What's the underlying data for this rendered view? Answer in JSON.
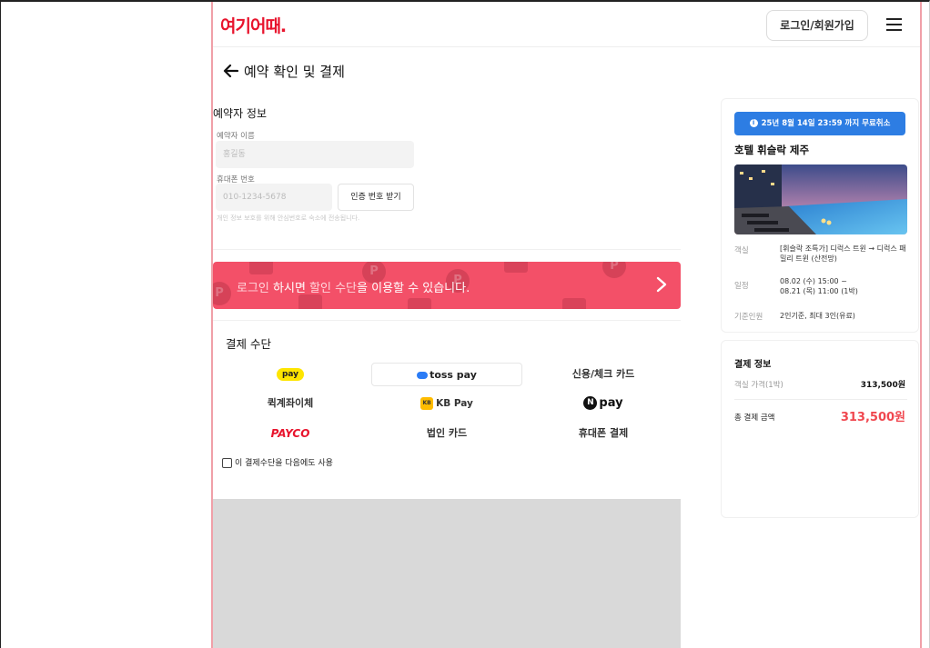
{
  "header": {
    "logo": "여기어때.",
    "login_label": "로그인/회원가입"
  },
  "page": {
    "title": "예약 확인 및 결제"
  },
  "booker": {
    "section_title": "예약자 정보",
    "name_label": "예약자 이름",
    "name_placeholder": "홍길동",
    "phone_label": "휴대폰 번호",
    "phone_placeholder": "010-1234-5678",
    "verify_label": "인증 번호 받기",
    "notice": "개인 정보 보호를 위해 안심번호로 숙소에 전송됩니다."
  },
  "banner": {
    "part1": "로그인",
    "part2": " 하시면 ",
    "part3": "할인 수단",
    "part4": "을 이용할 수 있습니다."
  },
  "payment": {
    "title": "결제 수단",
    "options": {
      "kakaopay": "pay",
      "tosspay": "toss pay",
      "card": "신용/체크 카드",
      "quick_transfer": "퀵계좌이체",
      "kbpay": "KB Pay",
      "kbpay_badge": "KB",
      "npay": "pay",
      "npay_badge": "N",
      "payco": "PAYCO",
      "corporate_card": "법인 카드",
      "phone_payment": "휴대폰 결제"
    },
    "remember_label": "이 결제수단을 다음에도 사용"
  },
  "summary": {
    "cancel_badge": "25년 8월 14일 23:59 까지 무료취소",
    "hotel_name": "호텔 휘슬락 제주",
    "room_label": "객실",
    "room_value": "[휘슬락 조특가] 디럭스 트윈 → 디럭스 패밀리 트윈 (산전망)",
    "schedule_label": "일정",
    "schedule_line1": "08.02 (수) 15:00 ~",
    "schedule_line2": "08.21 (목) 11:00 (1박)",
    "guests_label": "기준인원",
    "guests_value": "2인기준, 최대 3인(유료)"
  },
  "payment_info": {
    "title": "결제 정보",
    "room_price_label": "객실 가격(1박)",
    "room_price_value": "313,500원",
    "total_label": "총 결제 금액",
    "total_value": "313,500원"
  },
  "colors": {
    "brand_red": "#e8142d",
    "banner_pink": "#f35068",
    "badge_blue": "#2d7de3",
    "total_red": "#f0474f"
  }
}
